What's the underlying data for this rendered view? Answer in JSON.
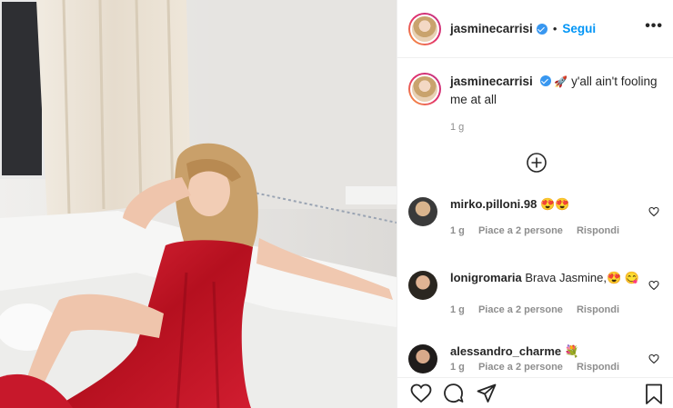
{
  "post": {
    "username": "jasminecarrisi",
    "follow_label": "Segui",
    "more_label": "•••",
    "caption_text": "y'all ain't fooling me at all",
    "caption_emoji": "🚀",
    "caption_time": "1 g"
  },
  "comments": [
    {
      "user": "mirko.pilloni.98",
      "text": "😍😍",
      "time": "1 g",
      "likes": "Piace a 2 persone",
      "reply": "Rispondi"
    },
    {
      "user": "lonigromaria",
      "text": "Brava Jasmine,😍 😋",
      "time": "1 g",
      "likes": "Piace a 2 persone",
      "reply": "Rispondi"
    },
    {
      "user": "alessandro_charme",
      "text": "💐",
      "time": "1 g",
      "likes": "Piace a 2 persone",
      "reply": "Rispondi"
    }
  ],
  "icons": {
    "like": "heart-icon",
    "comment": "comment-icon",
    "share": "share-icon",
    "save": "bookmark-icon",
    "add": "plus-circle-icon",
    "verified": "verified-badge-icon",
    "more": "more-options-icon"
  },
  "colors": {
    "follow": "#0095f6",
    "verified": "#3897f0",
    "dress": "#c4142a",
    "muted_text": "#8e8e8e"
  }
}
